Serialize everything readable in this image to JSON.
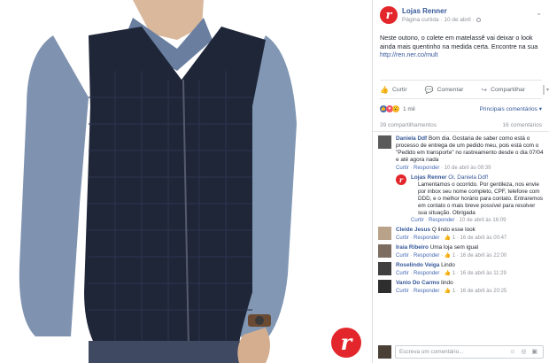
{
  "photo": {
    "alt_icon": "model-photo",
    "brand_badge": "r"
  },
  "post": {
    "page_logo": "r",
    "page_name": "Lojas Renner",
    "page_meta": "Página curtida · 10 de abril ·",
    "text": "Neste outono, o colete em matelassê vai deixar o look ainda mais quentinho na medida certa. Encontre na sua ",
    "link": "http://ren.ner.co/mult",
    "actions": {
      "like": "Curtir",
      "comment": "Comentar",
      "share": "Compartilhar"
    },
    "reaction_count": "1 mil",
    "sort_label": "Principais comentários ▾",
    "shares": "39 compartilhamentos",
    "comments_count": "16 comentários"
  },
  "comments": [
    {
      "author": "Daniela Ddf",
      "text": "Bom dia. Gostaria de saber como está o processo de entrega de um pedido meu, pois está com o \"Pedido em transporte\" no rastreamento desde o dia 07/04 e até agora nada",
      "meta": {
        "like": "Curtir",
        "reply": "Responder",
        "time": "· 10 de abril às 09:39"
      },
      "reply": {
        "author": "Lojas Renner",
        "mention": "Oi, Daniela Ddf!",
        "text": "Lamentamos o ocorrido. Por gentileza, nos envie por inbox seu nome completo, CPF, telefone com DDD, e o melhor horário para contato. Entraremos em contato o mais breve possível para resolver sua situação. Obrigada",
        "meta": {
          "like": "Curtir",
          "reply": "Responder",
          "time": "· 10 de abril às 16:09"
        }
      }
    },
    {
      "author": "Cleide Jesus",
      "text": "Q lindo esse look",
      "meta": {
        "like": "Curtir",
        "reply": "Responder",
        "likes": "👍 1",
        "time": "· 16 de abril às 00:47"
      }
    },
    {
      "author": "Iraia Ribeiro",
      "text": "Uma loja sem igual",
      "meta": {
        "like": "Curtir",
        "reply": "Responder",
        "likes": "👍 1",
        "time": "· 16 de abril às 22:00"
      }
    },
    {
      "author": "Roselindo Veiga",
      "text": "Lindo",
      "meta": {
        "like": "Curtir",
        "reply": "Responder",
        "likes": "👍 1",
        "time": "· 16 de abril às 11:29"
      }
    },
    {
      "author": "Vanio Do Carmo",
      "text": "lindo",
      "meta": {
        "like": "Curtir",
        "reply": "Responder",
        "likes": "👍 1",
        "time": "· 16 de abril às 20:25"
      }
    }
  ],
  "composer": {
    "placeholder": "Escreva um comentário...",
    "tools": "☺ ◎ ▣"
  }
}
